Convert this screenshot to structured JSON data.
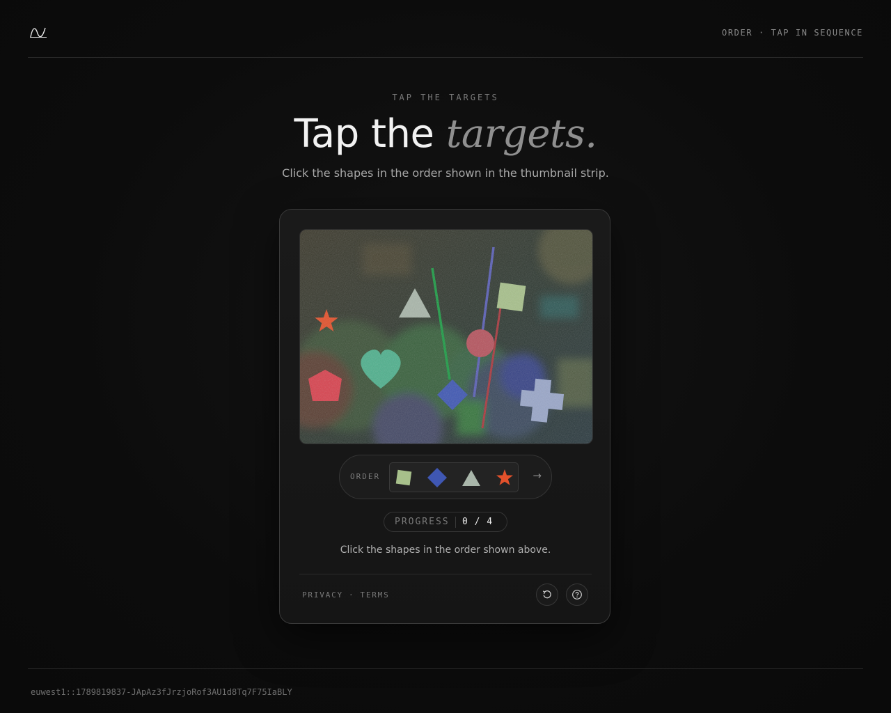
{
  "header": {
    "logo_icon": "wave-logo-icon",
    "right_label": "ORDER · TAP IN SEQUENCE"
  },
  "hero": {
    "eyebrow": "TAP THE TARGETS",
    "title_plain": "Tap the",
    "title_em": "targets.",
    "subtitle": "Click the shapes in the order shown in the thumbnail strip."
  },
  "challenge": {
    "order_label": "ORDER",
    "order_sequence": [
      "square",
      "diamond",
      "triangle",
      "star"
    ],
    "next_icon": "→",
    "progress_label": "PROGRESS",
    "progress_value": "0 / 4",
    "progress_done": 0,
    "progress_total": 4,
    "instruction": "Click the shapes in the order shown above.",
    "links": {
      "privacy": "PRIVACY",
      "separator": "·",
      "terms": "TERMS"
    },
    "buttons": {
      "refresh_icon": "refresh-icon",
      "help_icon": "help-icon"
    },
    "colors": {
      "square": "#a7c08b",
      "diamond": "#3f57b3",
      "triangle": "#a9b6aa",
      "star": "#e3512b",
      "heart": "#4fb08d",
      "pentagon": "#d8434f",
      "cross": "#9aa7c9",
      "circle": "#b5545e"
    }
  },
  "footer": {
    "session_id": "euwest1::1789819837-JApAz3fJrzjoRof3AU1d8Tq7F75IaBLY"
  }
}
